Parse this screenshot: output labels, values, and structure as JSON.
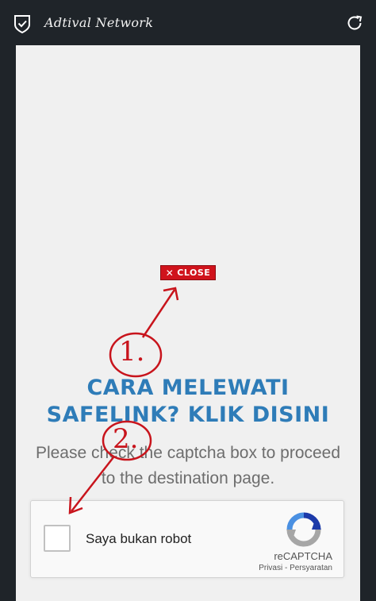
{
  "topbar": {
    "title": "Adtival Network",
    "shield_icon": "shield-check-icon",
    "refresh_icon": "refresh-icon"
  },
  "ad": {
    "close_label": "CLOSE",
    "close_icon": "x-icon"
  },
  "main": {
    "heading_line1": "CARA MELEWATI",
    "heading_line2": "SAFELINK? KLIK DISINI",
    "subtext_line1": "Please check the captcha box to proceed",
    "subtext_line2": "to the destination page."
  },
  "captcha": {
    "label": "Saya bukan robot",
    "brand": "reCAPTCHA",
    "links": "Privasi - Persyaratan"
  },
  "annotations": {
    "step1": "1.",
    "step2": "2."
  },
  "colors": {
    "topbar_bg": "#1f2429",
    "content_bg": "#f0f0f0",
    "heading": "#2e7cb8",
    "annotation": "#c8141c",
    "close_bg": "#d0131c"
  }
}
